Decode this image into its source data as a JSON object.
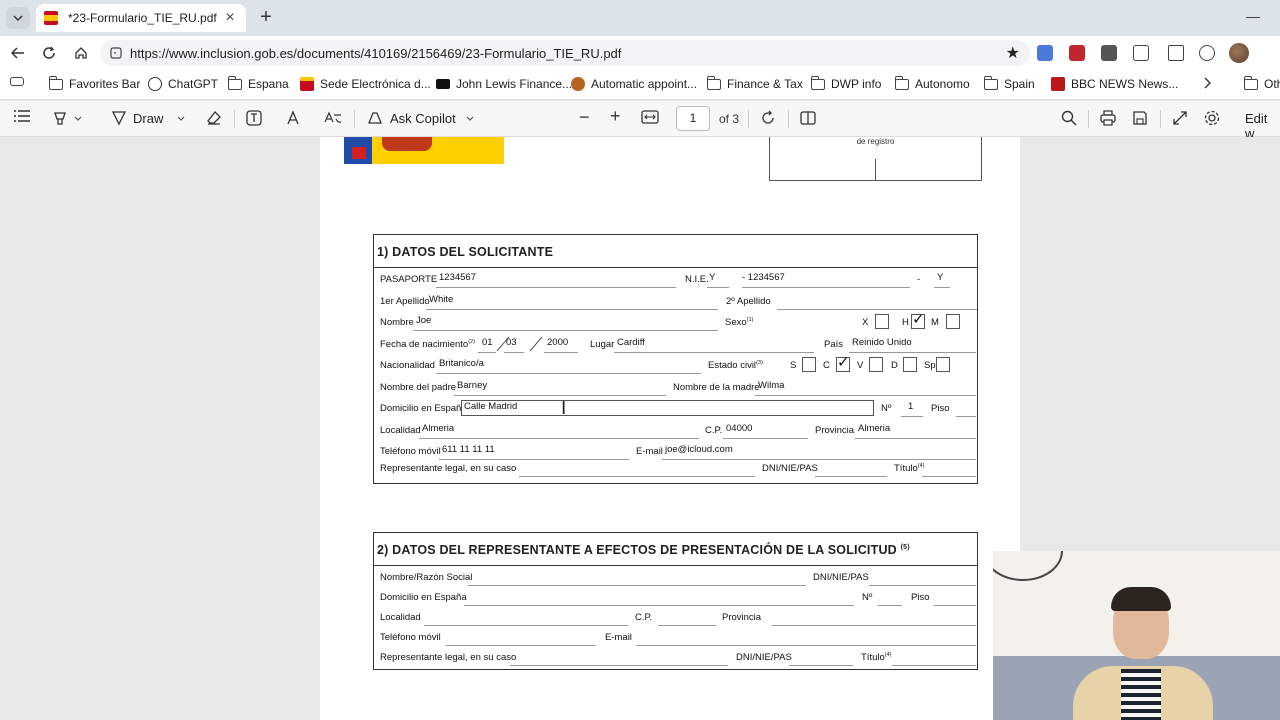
{
  "tab": {
    "title": "*23-Formulario_TIE_RU.pdf"
  },
  "address": {
    "url": "https://www.inclusion.gob.es/documents/410169/2156469/23-Formulario_TIE_RU.pdf"
  },
  "favorites": [
    {
      "label": "Favorites Bar",
      "icon": "folder-icon"
    },
    {
      "label": "ChatGPT",
      "icon": "chatgpt-icon"
    },
    {
      "label": "Espana",
      "icon": "folder-icon"
    },
    {
      "label": "Sede Electrónica d...",
      "icon": "spain-flag-icon"
    },
    {
      "label": "John Lewis Finance...",
      "icon": "john-lewis-icon"
    },
    {
      "label": "Automatic appoint...",
      "icon": "appointment-icon"
    },
    {
      "label": "Finance & Tax",
      "icon": "folder-icon"
    },
    {
      "label": "DWP info",
      "icon": "folder-icon"
    },
    {
      "label": "Autonomo",
      "icon": "folder-icon"
    },
    {
      "label": "Spain",
      "icon": "folder-icon"
    },
    {
      "label": "BBC NEWS  News...",
      "icon": "bbc-icon"
    },
    {
      "label": "Oth",
      "icon": "folder-icon"
    }
  ],
  "pdf_toolbar": {
    "draw_label": "Draw",
    "copilot_label": "Ask Copilot",
    "page_number": "1",
    "page_total": "of 3",
    "edit_label": "Edit w"
  },
  "stamp": {
    "label": "de registro"
  },
  "section1": {
    "title": "1)  DATOS DEL SOLICITANTE",
    "labels": {
      "pasaporte": "PASAPORTE",
      "nie": "N.I.E.",
      "apellido1": "1er Apellido",
      "apellido2": "2º Apellido",
      "nombre": "Nombre",
      "sexo": "Sexo",
      "sexo_sup": "(1)",
      "x": "X",
      "h": "H",
      "m": "M",
      "fecha": "Fecha de nacimiento",
      "fecha_sup": "(2)",
      "lugar": "Lugar",
      "pais": "País",
      "nacionalidad": "Nacionalidad",
      "estado_civil": "Estado civil",
      "estado_sup": "(3)",
      "s": "S",
      "c": "C",
      "v": "V",
      "d": "D",
      "sp": "Sp",
      "padre": "Nombre del padre",
      "madre": "Nombre de la madre",
      "domicilio": "Domicilio en España",
      "numero": "Nº",
      "piso": "Piso",
      "localidad": "Localidad",
      "cp": "C.P.",
      "provincia": "Provincia",
      "telefono": "Teléfono móvil",
      "email": "E-mail",
      "representante": "Representante legal, en su caso",
      "dni": "DNI/NIE/PAS",
      "titulo": "Título",
      "titulo_sup": "(4)"
    },
    "values": {
      "pasaporte": "1234567",
      "nie_letter": "Y",
      "nie_number": "- 1234567",
      "nie_dash": "-",
      "nie_end": "Y",
      "apellido1": "White",
      "nombre": "Joe",
      "dia": "01",
      "mes": "03",
      "anio": "2000",
      "lugar": "Cardiff",
      "pais": "Reinido Unido",
      "nacionalidad": "Britanico/a",
      "padre": "Barney",
      "madre": "Wilma",
      "domicilio": "Calle Madrid",
      "numero": "1",
      "localidad": "Almeria",
      "cp": "04000",
      "provincia": "Almeria",
      "telefono": "611 11 11 11",
      "email": "joe@icloud.com"
    }
  },
  "section2": {
    "title": "2)  DATOS DEL REPRESENTANTE A EFECTOS DE PRESENTACIÓN DE LA SOLICITUD",
    "title_sup": "(5)",
    "labels": {
      "nombre": "Nombre/Razón Social",
      "dni": "DNI/NIE/PAS",
      "domicilio": "Domicilio en España",
      "numero": "Nº",
      "piso": "Piso",
      "localidad": "Localidad",
      "cp": "C.P.",
      "provincia": "Provincia",
      "telefono": "Teléfono móvil",
      "email": "E-mail",
      "representante": "Representante legal, en su caso",
      "dni2": "DNI/NIE/PAS",
      "titulo": "Título",
      "titulo_sup": "(4)"
    }
  }
}
